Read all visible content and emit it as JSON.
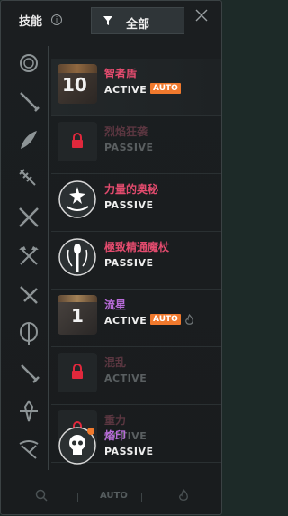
{
  "header": {
    "title": "技能",
    "filter_label": "全部"
  },
  "categories": [
    {
      "icon": "bomb-icon"
    },
    {
      "icon": "spear-icon"
    },
    {
      "icon": "feather-icon"
    },
    {
      "icon": "drill-icon"
    },
    {
      "icon": "crossed-swords-icon"
    },
    {
      "icon": "double-axe-icon"
    },
    {
      "icon": "crossed-blades-icon"
    },
    {
      "icon": "fork-icon"
    },
    {
      "icon": "sword-icon"
    },
    {
      "icon": "lance-icon"
    },
    {
      "icon": "crossbow-icon"
    }
  ],
  "skills": [
    {
      "name": "智者盾",
      "type": "ACTIVE",
      "number": "10",
      "auto_badge": "AUTO",
      "locked": false
    },
    {
      "name": "烈焰狂袭",
      "type": "PASSIVE",
      "locked": true
    },
    {
      "name": "力量的奥秘",
      "type": "PASSIVE",
      "locked": false
    },
    {
      "name": "極致精通魔杖",
      "type": "PASSIVE",
      "locked": false
    },
    {
      "name": "流星",
      "type": "ACTIVE",
      "number": "1",
      "auto_badge": "AUTO",
      "locked": false
    },
    {
      "name": "混乱",
      "type": "ACTIVE",
      "locked": true
    },
    {
      "name": "重力",
      "type": "ACTIVE",
      "locked": true
    },
    {
      "name": "烙印",
      "type": "PASSIVE",
      "locked": false
    }
  ],
  "footer": {
    "auto_label": "AUTO"
  },
  "colors": {
    "skill_name_active": "#e34b6e",
    "skill_name_purple": "#b86bd9",
    "auto_badge": "#f0792d",
    "locked_text": "#5a3640"
  }
}
